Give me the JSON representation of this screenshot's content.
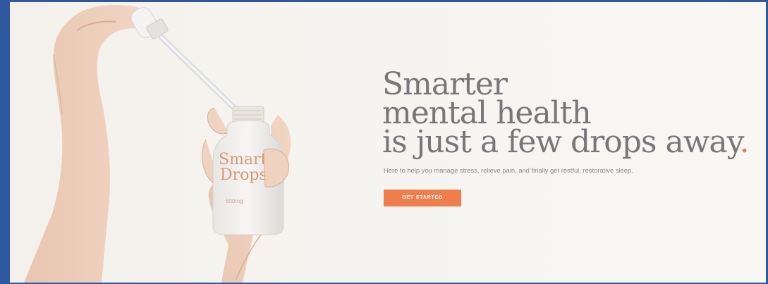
{
  "hero": {
    "headline_lines": [
      "Smarter",
      "mental health",
      "is just a few drops away"
    ],
    "headline_end": ".",
    "subtitle": "Here to help you manage stress, relieve pain, and finally get restful, restorative sleep.",
    "cta_label": "GET STARTED",
    "accent_color": "#f07e4c",
    "frame_color": "#2f58a0"
  },
  "product": {
    "brand_line_1": "Smart",
    "brand_line_2": "Drops",
    "dose": "500mg",
    "brand_icon": "leaf-icon"
  }
}
